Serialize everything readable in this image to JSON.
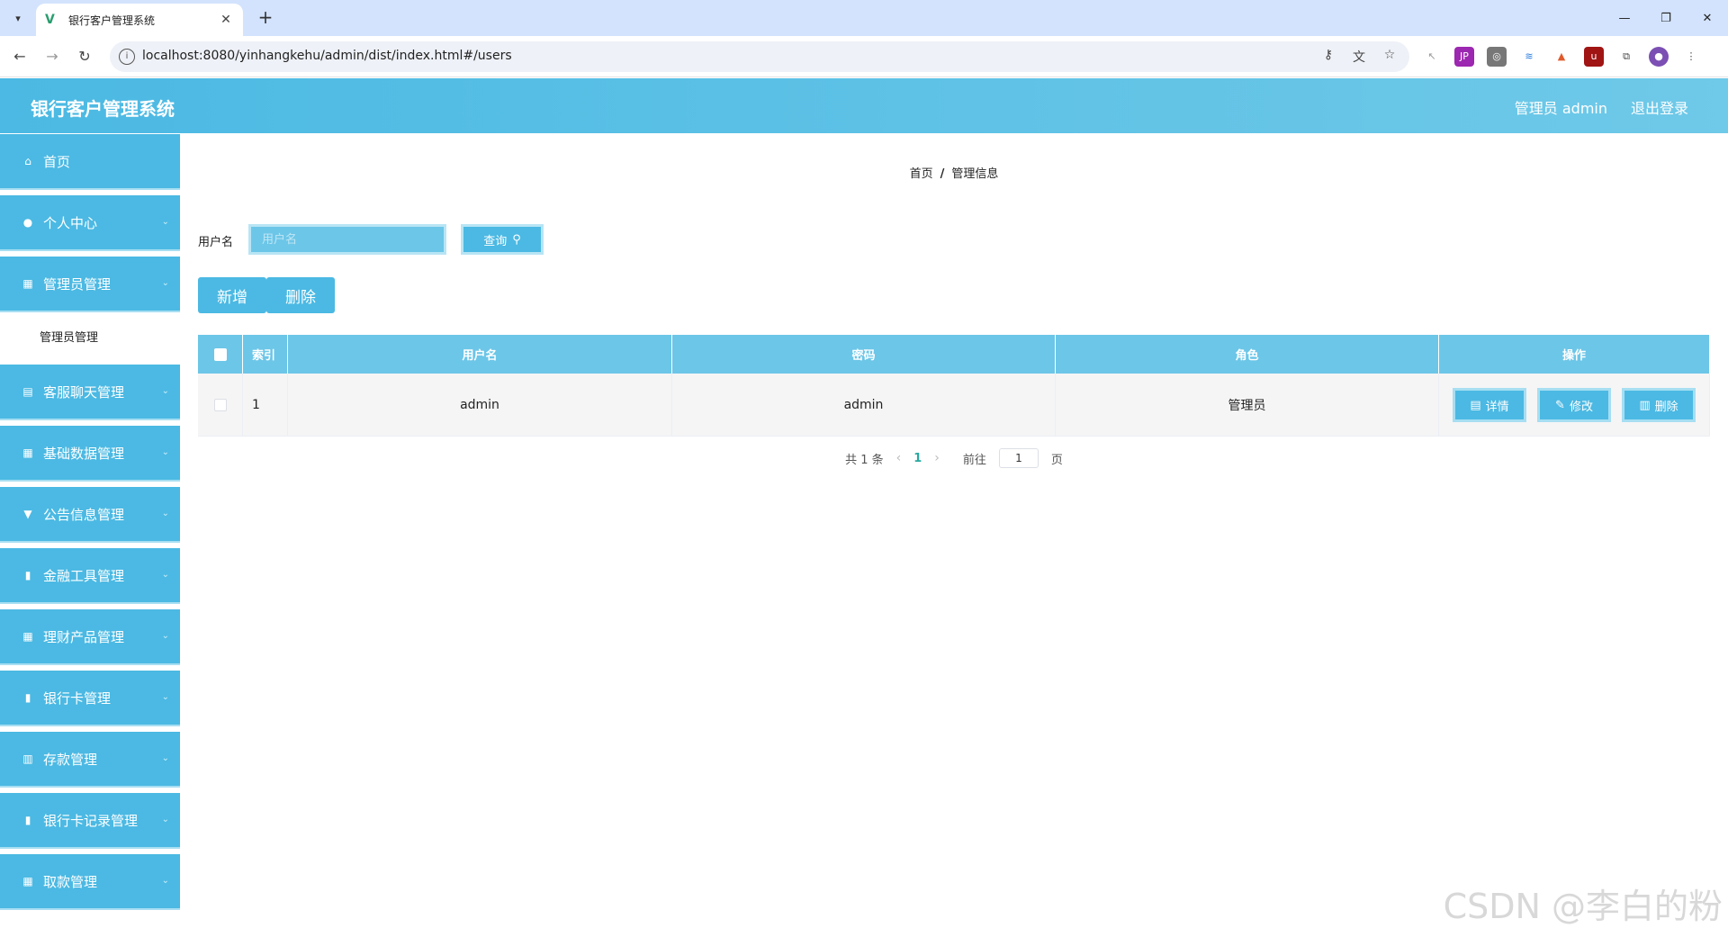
{
  "browser": {
    "tab_title": "银行客户管理系统",
    "url": "localhost:8080/yinhangkehu/admin/dist/index.html#/users"
  },
  "header": {
    "app_title": "银行客户管理系统",
    "user": "管理员 admin",
    "logout": "退出登录"
  },
  "sidebar": {
    "items": [
      {
        "label": "首页",
        "icon": "home-icon",
        "glyph": "⌂",
        "expandable": false
      },
      {
        "label": "个人中心",
        "icon": "user-icon",
        "glyph": "●",
        "expandable": true
      },
      {
        "label": "管理员管理",
        "icon": "grid-icon",
        "glyph": "▦",
        "expandable": true
      },
      {
        "label": "客服聊天管理",
        "icon": "grid-icon",
        "glyph": "▤",
        "expandable": true
      },
      {
        "label": "基础数据管理",
        "icon": "grid-icon",
        "glyph": "▦",
        "expandable": true
      },
      {
        "label": "公告信息管理",
        "icon": "flag-icon",
        "glyph": "▼",
        "expandable": true
      },
      {
        "label": "金融工具管理",
        "icon": "clipboard-icon",
        "glyph": "▮",
        "expandable": true
      },
      {
        "label": "理财产品管理",
        "icon": "grid-icon",
        "glyph": "▦",
        "expandable": true
      },
      {
        "label": "银行卡管理",
        "icon": "clipboard-icon",
        "glyph": "▮",
        "expandable": true
      },
      {
        "label": "存款管理",
        "icon": "bar-chart-icon",
        "glyph": "▥",
        "expandable": true
      },
      {
        "label": "银行卡记录管理",
        "icon": "clipboard-icon",
        "glyph": "▮",
        "expandable": true
      },
      {
        "label": "取款管理",
        "icon": "grid-icon",
        "glyph": "▦",
        "expandable": true
      }
    ],
    "submenu_label": "管理员管理"
  },
  "main": {
    "breadcrumb": [
      "首页",
      "管理信息"
    ],
    "search_label": "用户名",
    "search_placeholder": "用户名",
    "query_label": "查询",
    "add_label": "新增",
    "delete_label": "删除",
    "table": {
      "headers": [
        "索引",
        "用户名",
        "密码",
        "角色",
        "操作"
      ],
      "rows": [
        {
          "index": "1",
          "username": "admin",
          "password": "admin",
          "role": "管理员"
        }
      ],
      "ops": [
        "详情",
        "修改",
        "删除"
      ]
    },
    "pagination": {
      "total": "共 1 条",
      "current": "1",
      "goto_label": "前往",
      "goto_value": "1",
      "page_suffix": "页"
    }
  },
  "watermark": "CSDN @李白的粉"
}
